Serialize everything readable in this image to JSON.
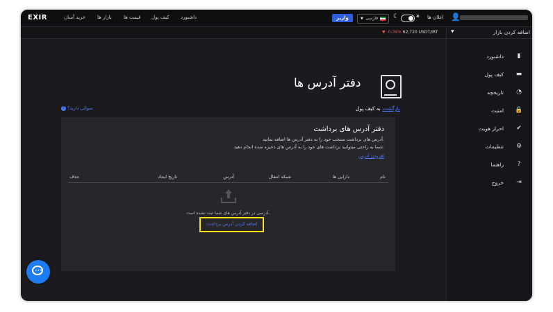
{
  "topbar": {
    "logo": "EXIR",
    "nav": [
      "داشبورد",
      "کیف پول",
      "قیمت ها",
      "بازار ها",
      "خرید آسان"
    ],
    "deposit_label": "واریز",
    "language": "فارسی",
    "announcements": "اعلان ها"
  },
  "ticker": {
    "change": "-0.36%",
    "pair": "62,720 USDT/IRT"
  },
  "sidebar": {
    "add_market": "اضافه کردن بازار",
    "items": [
      {
        "label": "داشبورد",
        "icon": "chart-icon"
      },
      {
        "label": "کیف پول",
        "icon": "wallet-icon"
      },
      {
        "label": "تاریخچه",
        "icon": "history-icon"
      },
      {
        "label": "امنیت",
        "icon": "lock-icon"
      },
      {
        "label": "احراز هویت",
        "icon": "verify-icon"
      },
      {
        "label": "تنظیمات",
        "icon": "gear-icon"
      },
      {
        "label": "راهنما",
        "icon": "help-icon"
      },
      {
        "label": "خروج",
        "icon": "logout-icon"
      }
    ]
  },
  "page": {
    "title": "دفتر آدرس ها",
    "back_link": "بازگشت",
    "back_suffix": " به کیف پول",
    "help": "سوالی دارید؟"
  },
  "card": {
    "title": "دفتر آدرس های برداشت",
    "desc1": "آدرس های برداشت منتخب خود را به دفتر آدرس ها اضافه نمایید.",
    "desc2": "شما به راحتی میتوانید برداشت های خود را به آدرس های ذخیره شده انجام دهید.",
    "add_link": "افزودن آدرس",
    "columns": {
      "name": "نام",
      "asset": "دارایی ها",
      "network": "شبکه انتقال",
      "address": "آدرس",
      "created": "تاریخ ایجاد",
      "delete": "حذف"
    },
    "empty_text": "آدرسی در دفتر آدرس های شما ثبت نشده است.",
    "add_button": "اضافه کردن آدرس برداشت"
  },
  "colors": {
    "accent": "#2f5de0",
    "link": "#4f78f0",
    "highlight": "#f5e216",
    "negative": "#f05a4a"
  }
}
